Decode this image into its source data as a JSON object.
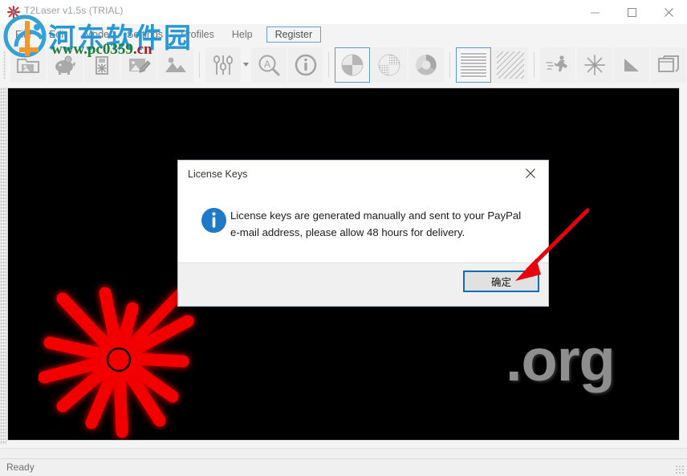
{
  "window": {
    "title": "T2Laser v1.5s (TRIAL)",
    "icon": "laser-burst-icon",
    "controls": {
      "minimize": "minimize-icon",
      "maximize": "maximize-icon",
      "close": "close-icon"
    }
  },
  "menubar": {
    "items": [
      {
        "label": "File",
        "boxed": false
      },
      {
        "label": "Edit",
        "boxed": false
      },
      {
        "label": "Mode",
        "boxed": false
      },
      {
        "label": "Settings",
        "boxed": false
      },
      {
        "label": "Profiles",
        "boxed": false
      },
      {
        "label": "Help",
        "boxed": false
      },
      {
        "label": "Register",
        "boxed": true
      }
    ]
  },
  "toolbar": {
    "groups": [
      {
        "buttons": [
          {
            "icon": "open-image-folder-icon",
            "active": false
          },
          {
            "icon": "piggy-bank-save-icon",
            "active": false
          },
          {
            "icon": "usb-laser-device-icon",
            "active": false
          },
          {
            "icon": "edit-image-icon",
            "active": false
          },
          {
            "icon": "image-picture-icon",
            "active": false
          }
        ]
      },
      {
        "buttons": [
          {
            "icon": "sliders-adjust-icon",
            "active": false,
            "caret": true
          },
          {
            "icon": "autotrace-magnifier-icon",
            "active": false
          },
          {
            "icon": "info-circle-icon",
            "active": false
          }
        ]
      },
      {
        "buttons": [
          {
            "icon": "pie-dither-icon",
            "active": true
          },
          {
            "icon": "pie-halftone-icon",
            "active": false
          },
          {
            "icon": "circle-grayscale-icon",
            "active": false
          }
        ]
      },
      {
        "buttons": [
          {
            "icon": "horizontal-scan-lines-icon",
            "active": true
          },
          {
            "icon": "diagonal-hatch-icon",
            "active": false
          }
        ]
      },
      {
        "buttons": [
          {
            "icon": "running-man-speed-icon",
            "active": false
          },
          {
            "icon": "laser-burst-power-icon",
            "active": false
          },
          {
            "icon": "triangle-ramp-icon",
            "active": false
          },
          {
            "icon": "window-tile-icon",
            "active": false
          }
        ]
      }
    ]
  },
  "canvas": {
    "background_color": "#000000",
    "artwork_label": ".org",
    "laser_graphic": "red-laser-starburst",
    "laser_color": "#ff0000"
  },
  "watermark": {
    "chinese": "河东软件园",
    "url_name": "www.pc0359",
    "url_domain": ".cn",
    "logo": "he-dong-logo-icon",
    "chinese_color": "#2196d6",
    "url_color": "#167a2e",
    "domain_color": "#9c1b1b"
  },
  "statusbar": {
    "text": "Ready",
    "grip": "resize-grip-icon"
  },
  "dialog": {
    "title": "License Keys",
    "close": "dialog-close-icon",
    "icon": "info-icon",
    "message": "License keys are generated manually and sent to your PayPal e-mail address, please allow 48 hours for delivery.",
    "ok_label": "确定",
    "focus_border_color": "#0f6cbd"
  },
  "annotation": {
    "arrow": "red-pointer-arrow",
    "color": "#e8000a"
  }
}
